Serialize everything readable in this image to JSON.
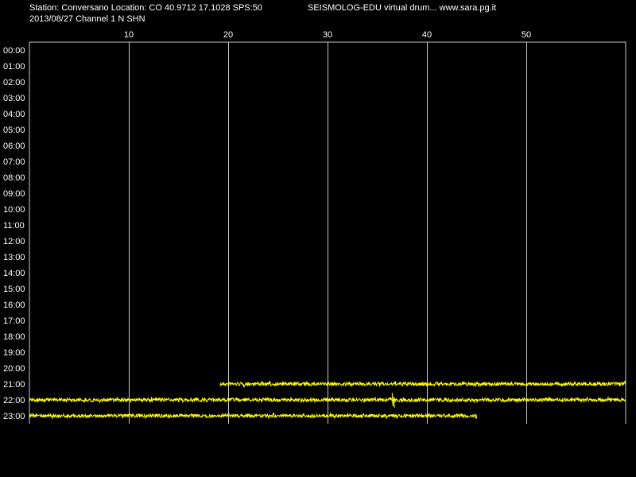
{
  "header": {
    "station_line": "Station: Conversano Location: CO 40.9712 17.1028 SPS:50",
    "app_line": "SEISMOLOG-EDU virtual drum... www.sara.pg.it",
    "date_line": "2013/08/27  Channel 1 N SHN"
  },
  "colors": {
    "background": "#000000",
    "trace": "#ffff00",
    "grid": "#c8c8c8",
    "text": "#ffffff"
  },
  "chart_data": {
    "type": "line",
    "title": "",
    "xlabel": "",
    "ylabel": "",
    "x_unit_range": [
      0,
      60
    ],
    "x_ticks": [
      10,
      20,
      30,
      40,
      50
    ],
    "x_tick_labels": [
      "10",
      "20",
      "30",
      "40",
      "50"
    ],
    "y_rows": [
      "00:00",
      "01:00",
      "02:00",
      "03:00",
      "04:00",
      "05:00",
      "06:00",
      "07:00",
      "08:00",
      "09:00",
      "10:00",
      "11:00",
      "12:00",
      "13:00",
      "14:00",
      "15:00",
      "16:00",
      "17:00",
      "18:00",
      "19:00",
      "20:00",
      "21:00",
      "22:00",
      "23:00"
    ],
    "grid": true,
    "series": [
      {
        "row": "21:00",
        "start_minute": 19.2,
        "end_minute": 60,
        "events": []
      },
      {
        "row": "22:00",
        "start_minute": 0,
        "end_minute": 60,
        "events": [
          36.5
        ]
      },
      {
        "row": "23:00",
        "start_minute": 0,
        "end_minute": 45
      }
    ]
  }
}
